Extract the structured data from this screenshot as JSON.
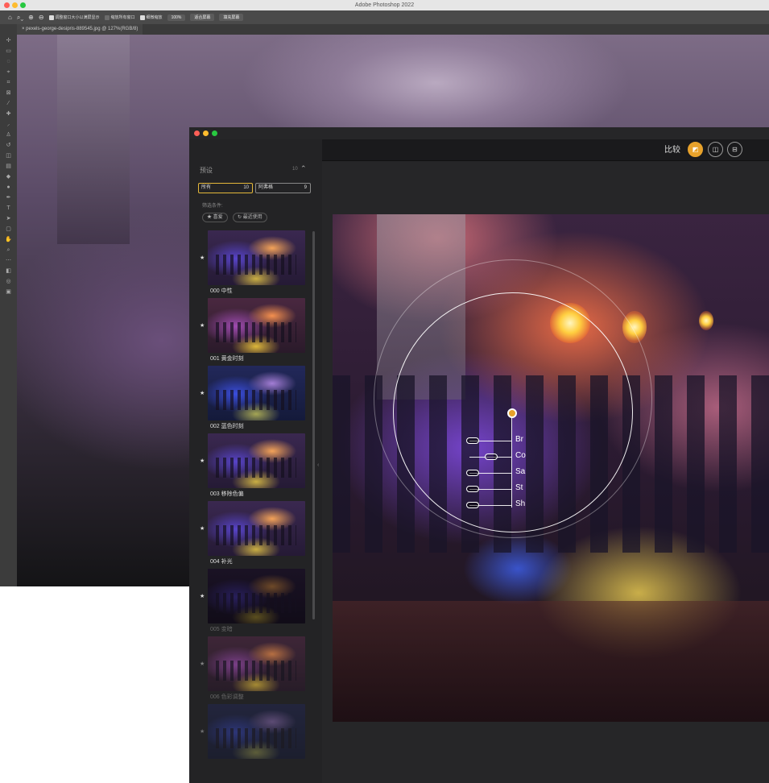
{
  "photoshop": {
    "app_title": "Adobe Photoshop 2022",
    "options": {
      "resize_windows": "调整窗口大小以满屏显示",
      "zoom_all": "缩放所有窗口",
      "scrubby_zoom": "细微缩放",
      "zoom_level": "100%",
      "fit_screen": "适合屏幕",
      "fill_screen": "填充屏幕"
    },
    "doc_tab": "pexels-george-desipris-889545.jpg @ 127%(RGB/8)"
  },
  "nik": {
    "compare_label": "比较",
    "sidebar": {
      "heading": "预设",
      "count": "10",
      "filters": [
        {
          "label": "所有",
          "count": "10"
        },
        {
          "label": "阿弗格",
          "count": "9"
        }
      ],
      "filter_label": "筛选条件:",
      "chips": [
        "★ 喜爱",
        "↻ 最近使用"
      ],
      "presets": [
        {
          "label": "000 中性"
        },
        {
          "label": "001 黄金时刻"
        },
        {
          "label": "002 蓝色时刻"
        },
        {
          "label": "003 移除色偏"
        },
        {
          "label": "004 补光"
        },
        {
          "label": "005 变暗"
        },
        {
          "label": "006 色彩调整"
        }
      ]
    },
    "control_point": {
      "sliders": [
        "Br",
        "Co",
        "Sa",
        "St",
        "Sh"
      ]
    }
  },
  "colors": {
    "accent": "#e4b83a",
    "compare_active": "#e8a22b"
  }
}
